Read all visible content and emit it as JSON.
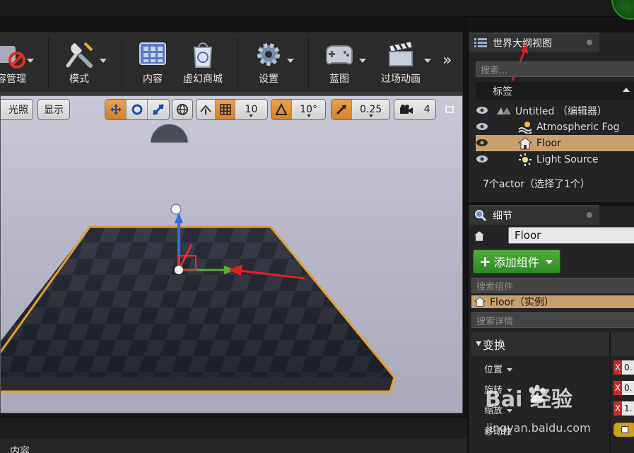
{
  "toolbar": {
    "items": [
      {
        "label": "容管理",
        "icon": "content-manage-icon"
      },
      {
        "label": "模式",
        "icon": "modes-icon"
      },
      {
        "label": "内容",
        "icon": "content-icon"
      },
      {
        "label": "虚幻商城",
        "icon": "marketplace-icon"
      },
      {
        "label": "设置",
        "icon": "settings-icon"
      },
      {
        "label": "蓝图",
        "icon": "blueprint-icon"
      },
      {
        "label": "过场动画",
        "icon": "cinematics-icon"
      }
    ],
    "more": "»"
  },
  "viewport": {
    "lit_label": "光照",
    "show_label": "显示",
    "grid_value": "10",
    "rotation_value": "10°",
    "scale_value": "0.25",
    "camera_speed": "4"
  },
  "outliner": {
    "tab_title": "世界大纲视图",
    "search_placeholder": "搜索...",
    "column_header": "标签",
    "rows": [
      {
        "label": "Untitled （编辑器）",
        "selected": false
      },
      {
        "label": "Atmospheric Fog",
        "selected": false
      },
      {
        "label": "Floor",
        "selected": true
      },
      {
        "label": "Light Source",
        "selected": false
      }
    ],
    "status": "7个actor（选择了1个）"
  },
  "details": {
    "tab_title": "细节",
    "name_value": "Floor",
    "add_component_label": "添加组件",
    "search_components_placeholder": "搜索组件",
    "component_row": "Floor（实例）",
    "search_details_placeholder": "搜索详情",
    "section_title": "变换",
    "props": [
      {
        "label": "位置",
        "x_label": "X",
        "x_value": "0."
      },
      {
        "label": "旋转",
        "x_label": "X",
        "x_value": "0."
      },
      {
        "label": "缩放",
        "x_label": "X",
        "x_value": "1."
      },
      {
        "label": "移动性",
        "x_label": "",
        "x_value": ""
      }
    ]
  },
  "bottom": {
    "tab_label": "内容"
  },
  "watermark": {
    "brand": "Bai  经验",
    "url": "jingyan.baidu.com"
  },
  "colors": {
    "accent_orange": "#d6822a",
    "selection": "#c8a070",
    "add_green": "#3c9e2e",
    "arrow_red": "#e02020",
    "floor_outline": "#e0a030"
  }
}
